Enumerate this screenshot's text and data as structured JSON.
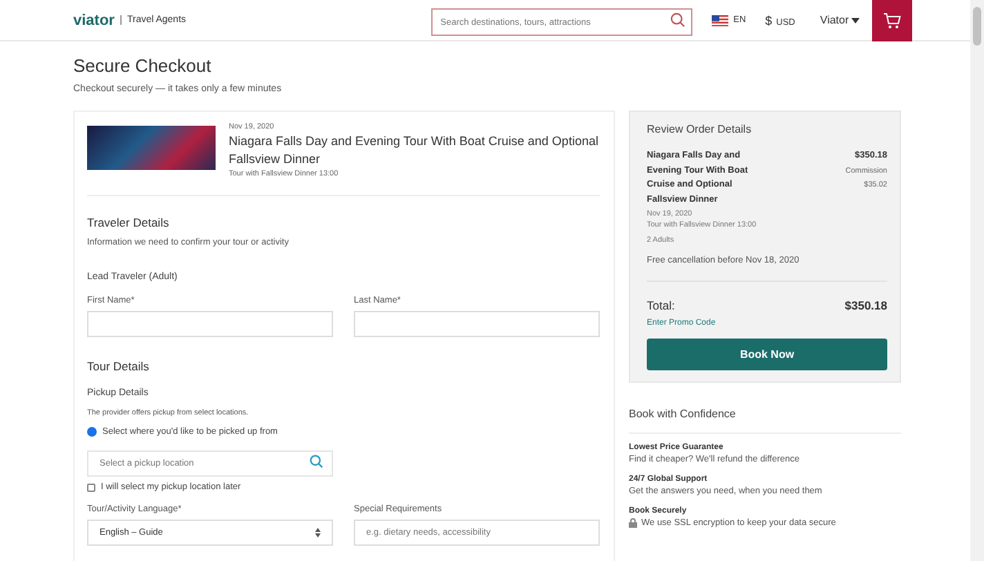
{
  "header": {
    "logo": "viator",
    "logo_subtitle": "Travel Agents",
    "search": {
      "placeholder": "Search destinations, tours, attractions"
    },
    "language": "EN",
    "currency_symbol": "$",
    "currency": "USD",
    "account": "Viator"
  },
  "page": {
    "title": "Secure Checkout",
    "subtitle": "Checkout securely — it takes only a few minutes"
  },
  "tour": {
    "date": "Nov 19, 2020",
    "title": "Niagara Falls Day and Evening Tour With Boat Cruise and Optional Fallsview Dinner",
    "option": "Tour with Fallsview Dinner 13:00"
  },
  "traveler_details": {
    "heading": "Traveler Details",
    "description": "Information we need to confirm your tour or activity",
    "lead_label": "Lead Traveler (Adult)",
    "fields": [
      {
        "label": "First Name*"
      },
      {
        "label": "Last Name*"
      }
    ]
  },
  "tour_details": {
    "heading": "Tour Details",
    "pickup_heading": "Pickup Details",
    "pickup_note": "The provider offers pickup from select locations.",
    "pickup_radio": {
      "label": "Select where you'd like to be picked up from",
      "selected": true
    },
    "pickup_search": {
      "placeholder": "Select a pickup location"
    },
    "pickup_later": {
      "label": "I will select my pickup location later",
      "checked": false
    },
    "language": {
      "label": "Tour/Activity Language*",
      "value": "English – Guide"
    },
    "requirements": {
      "label": "Special Requirements",
      "placeholder": "e.g. dietary needs, accessibility"
    }
  },
  "review": {
    "heading": "Review Order Details",
    "item_title": "Niagara Falls Day and Evening Tour With Boat Cruise and Optional Fallsview Dinner",
    "price": "$350.18",
    "commission_label": "Commission",
    "commission": "$35.02",
    "date": "Nov 19, 2020",
    "option": "Tour with Fallsview Dinner 13:00",
    "travelers": "2 Adults",
    "cancellation": "Free cancellation before Nov 18, 2020",
    "total_label": "Total:",
    "total": "$350.18",
    "promo_link": "Enter Promo Code",
    "book_button": "Book Now"
  },
  "confidence": {
    "heading": "Book with Confidence",
    "items": [
      {
        "title": "Lowest Price Guarantee",
        "text": "Find it cheaper? We'll refund the difference"
      },
      {
        "title": "24/7 Global Support",
        "text": "Get the answers you need, when you need them"
      },
      {
        "title": "Book Securely",
        "text": "We use SSL encryption to keep your data secure"
      }
    ]
  }
}
